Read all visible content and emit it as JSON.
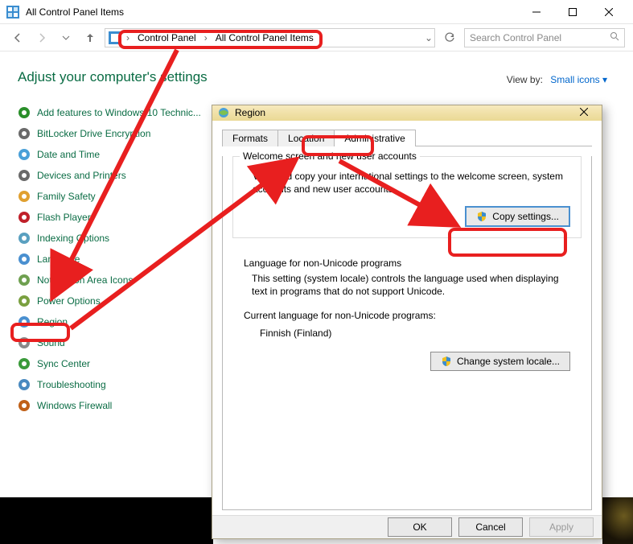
{
  "window": {
    "title": "All Control Panel Items"
  },
  "nav": {
    "breadcrumb": [
      "Control Panel",
      "All Control Panel Items"
    ],
    "search_placeholder": "Search Control Panel"
  },
  "page": {
    "heading": "Adjust your computer's settings",
    "viewby_label": "View by:",
    "viewby_value": "Small icons"
  },
  "items": [
    {
      "label": "Add features to Windows 10 Technic...",
      "icon_color": "#2a8f2a"
    },
    {
      "label": "BitLocker Drive Encryption",
      "icon_color": "#6a6a6a"
    },
    {
      "label": "Date and Time",
      "icon_color": "#4aa0d8"
    },
    {
      "label": "Devices and Printers",
      "icon_color": "#6a6a6a"
    },
    {
      "label": "Family Safety",
      "icon_color": "#e0a030"
    },
    {
      "label": "Flash Player",
      "icon_color": "#c0202a"
    },
    {
      "label": "Indexing Options",
      "icon_color": "#5aa0c0"
    },
    {
      "label": "Language",
      "icon_color": "#4a90d0"
    },
    {
      "label": "Notification Area Icons",
      "icon_color": "#6fa050"
    },
    {
      "label": "Power Options",
      "icon_color": "#7aa040"
    },
    {
      "label": "Region",
      "icon_color": "#4a90d0"
    },
    {
      "label": "Sound",
      "icon_color": "#8a8a8a"
    },
    {
      "label": "Sync Center",
      "icon_color": "#3a9a3a"
    },
    {
      "label": "Troubleshooting",
      "icon_color": "#4a8ac0"
    },
    {
      "label": "Windows Firewall",
      "icon_color": "#c06018"
    }
  ],
  "dialog": {
    "title": "Region",
    "tabs": [
      "Formats",
      "Location",
      "Administrative"
    ],
    "active_tab": 2,
    "welcome_group": {
      "legend": "Welcome screen and new user accounts",
      "text": "View and copy your international settings to the welcome screen, system accounts and new user accounts.",
      "button": "Copy settings..."
    },
    "locale_group": {
      "legend": "Language for non-Unicode programs",
      "text": "This setting (system locale) controls the language used when displaying text in programs that do not support Unicode.",
      "current_label": "Current language for non-Unicode programs:",
      "current_value": "Finnish (Finland)",
      "button": "Change system locale..."
    },
    "footer": {
      "ok": "OK",
      "cancel": "Cancel",
      "apply": "Apply"
    }
  }
}
